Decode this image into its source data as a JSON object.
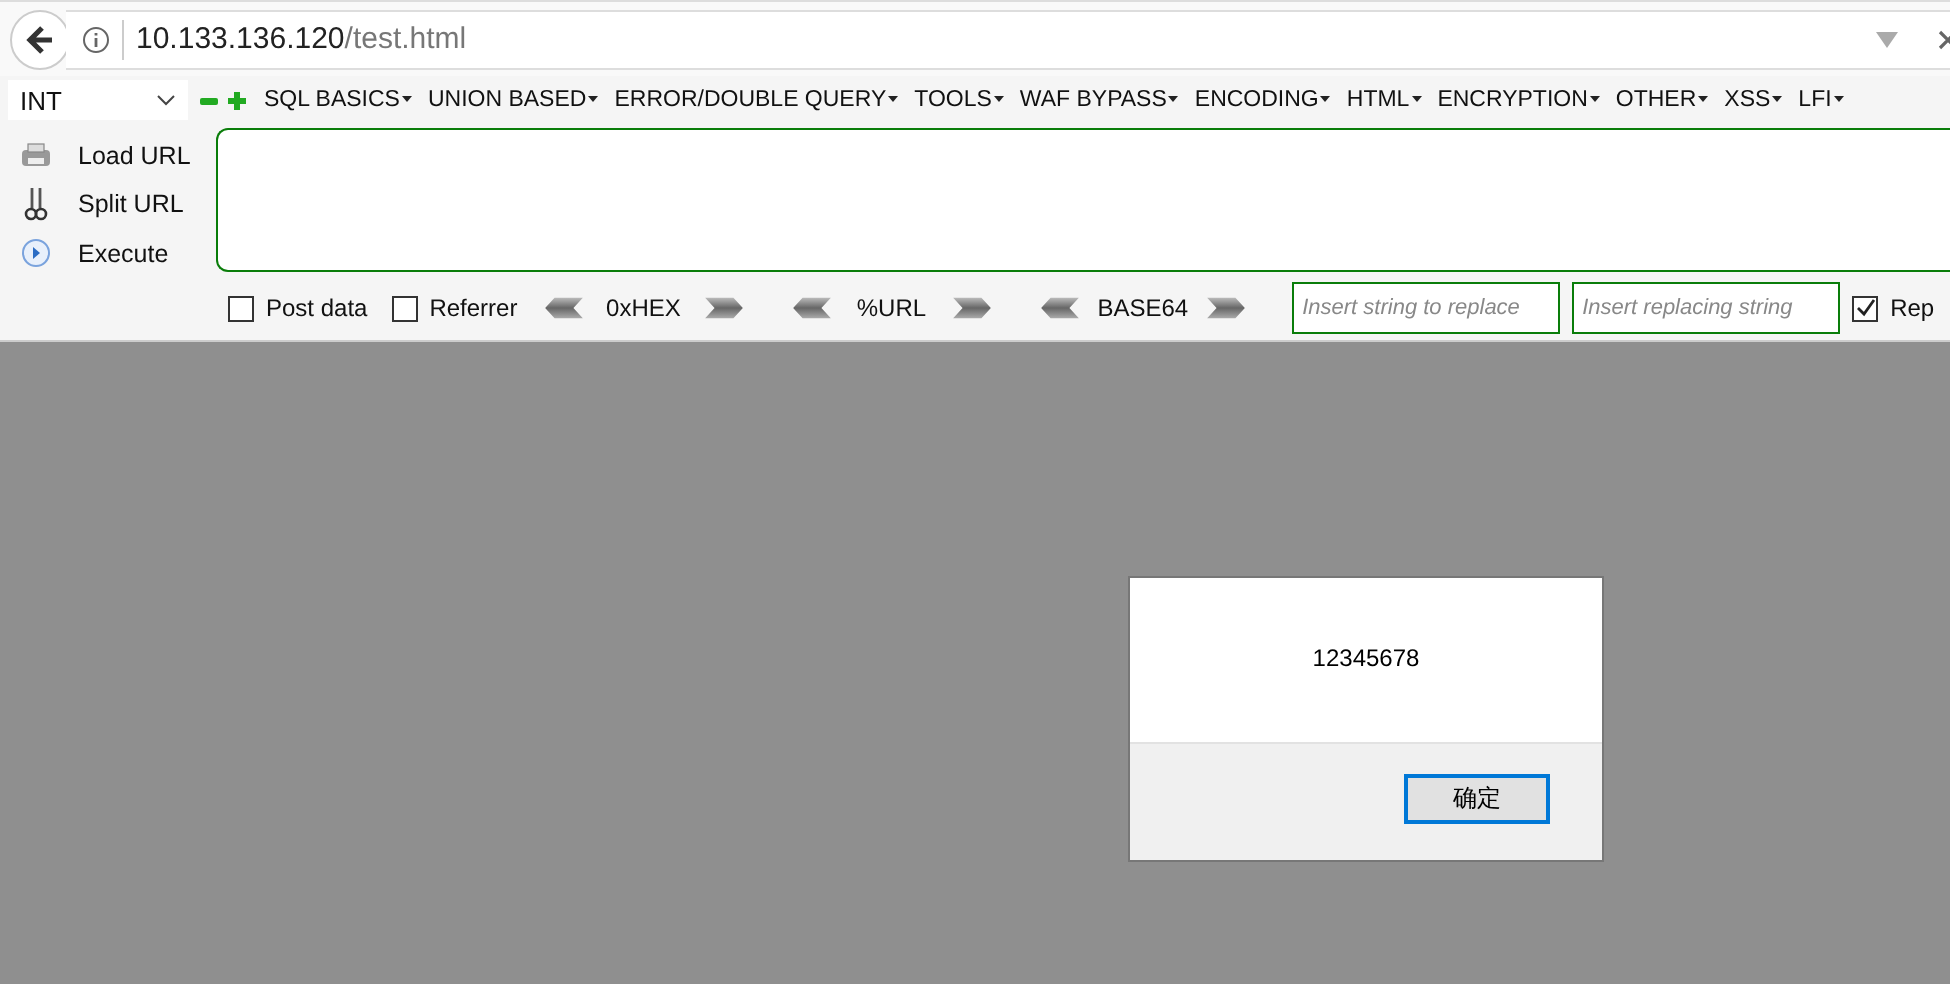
{
  "address_bar": {
    "host": "10.133.136.120",
    "path": "/test.html"
  },
  "hackbar": {
    "select": {
      "value": "INT"
    },
    "menus": [
      "SQL BASICS",
      "UNION BASED",
      "ERROR/DOUBLE QUERY",
      "TOOLS",
      "WAF BYPASS",
      "ENCODING",
      "HTML",
      "ENCRYPTION",
      "OTHER",
      "XSS",
      "LFI"
    ],
    "actions": [
      {
        "kind": "load",
        "label": "Load URL"
      },
      {
        "kind": "split",
        "label": "Split URL"
      },
      {
        "kind": "execute",
        "label": "Execute"
      }
    ],
    "options": [
      {
        "label": "Post data",
        "checked": false
      },
      {
        "label": "Referrer",
        "checked": false
      }
    ],
    "encoders": [
      "0xHEX",
      "%URL",
      "BASE64"
    ],
    "replace_fields": [
      {
        "placeholder": "Insert string to replace"
      },
      {
        "placeholder": "Insert replacing string"
      }
    ],
    "replace_option": {
      "label": "Rep",
      "checked": true
    }
  },
  "alert": {
    "message": "12345678",
    "button": "确定"
  }
}
